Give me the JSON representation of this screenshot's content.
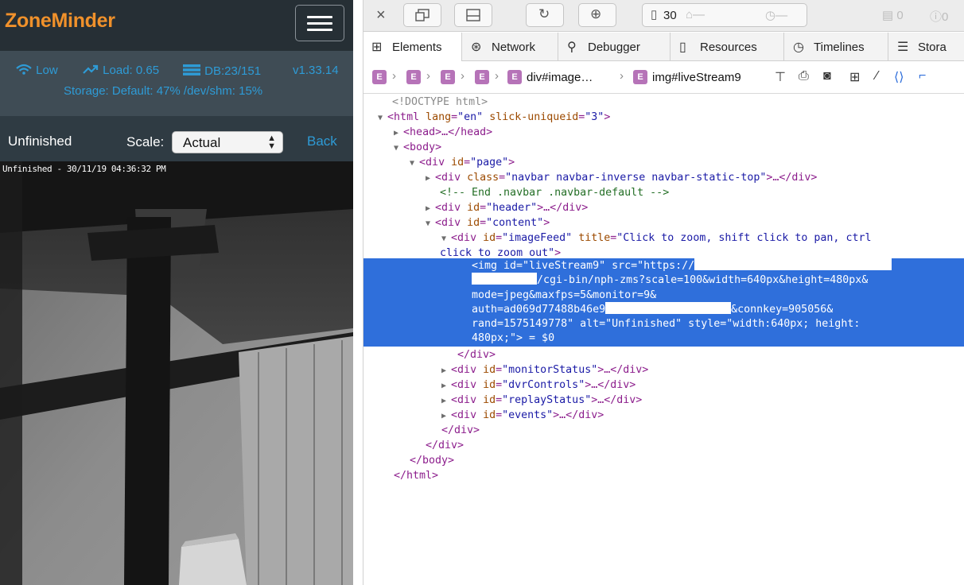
{
  "app": {
    "brand": "ZoneMinder",
    "status": {
      "bandwidth": "Low",
      "load": "Load: 0.65",
      "db": "DB:23/151",
      "version": "v1.33.14",
      "storage": "Storage: Default: 47% /dev/shm: 15%"
    },
    "monitor": {
      "name": "Unfinished",
      "scale_label": "Scale:",
      "scale_value": "Actual",
      "back_label": "Back"
    },
    "feed": {
      "overlay_text": "Unfinished - 30/11/19 04:36:32 PM"
    },
    "colors": {
      "brand": "#f0912b",
      "link": "#2e9bd6",
      "navbar": "#262f35"
    }
  },
  "inspector": {
    "toolbar": {
      "resource_count": "30",
      "warnings": "0",
      "errors": "0"
    },
    "tabs": [
      "Elements",
      "Network",
      "Debugger",
      "Resources",
      "Timelines",
      "Stora"
    ],
    "breadcrumb": {
      "elem_letter": "E",
      "crumb_image_feed": "div#image…",
      "crumb_live_stream": "img#liveStream9"
    },
    "dom": {
      "doctype": "<!DOCTYPE html>",
      "html_open": "<html",
      "html_lang_attr": "lang",
      "html_lang_val": "\"en\"",
      "html_slick_attr": "slick-uniqueid",
      "html_slick_val": "\"3\"",
      "head": "<head>…</head>",
      "body_open": "<body>",
      "page_open": "<div",
      "page_id_attr": "id",
      "page_id_val": "\"page\"",
      "navbar_tag": "<div",
      "navbar_class_attr": "class",
      "navbar_class_val": "\"navbar navbar-inverse navbar-static-top\"",
      "navbar_close": ">…</div>",
      "comment": "<!-- End .navbar .navbar-default -->",
      "header_val": "\"header\"",
      "content_val": "\"content\"",
      "imagefeed_val": "\"imageFeed\"",
      "imagefeed_title_attr": "title",
      "imagefeed_title_val_1": "\"Click to zoom, shift click to pan, ctrl",
      "imagefeed_title_val_2": "click to zoom out\"",
      "img_line_1": "<img id=\"liveStream9\" src=\"https://",
      "img_line_2": "/cgi-bin/nph-zms?scale=100&width=640px&height=480px&",
      "img_line_3": "mode=jpeg&maxfps=5&monitor=9&",
      "img_line_4a": "auth=ad069d77488b46e9",
      "img_line_4b": "&connkey=905056&",
      "img_line_5": "rand=1575149778\" alt=\"Unfinished\" style=\"width:640px; height:",
      "img_line_6": "480px;\"> = $0",
      "div_close": "</div>",
      "monitor_status_val": "\"monitorStatus\"",
      "dvr_controls_val": "\"dvrControls\"",
      "replay_status_val": "\"replayStatus\"",
      "events_val": "\"events\"",
      "body_close": "</body>",
      "html_close": "</html>",
      "collapsed_close": ">…</div>",
      "open_gt": ">"
    }
  }
}
